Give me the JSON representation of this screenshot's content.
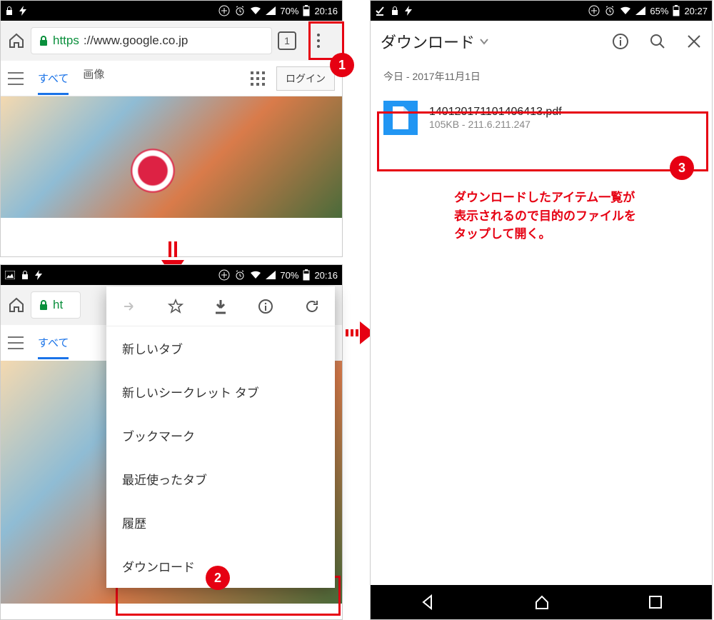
{
  "screen1": {
    "status": {
      "battery": "70%",
      "time": "20:16"
    },
    "url": {
      "httpsPrefix": "https",
      "rest": "://www.google.co.jp"
    },
    "tabCount": "1",
    "gtabs": {
      "all": "すべて",
      "images": "画像"
    },
    "login": "ログイン"
  },
  "screen2": {
    "status": {
      "battery": "70%",
      "time": "20:16"
    },
    "url": {
      "httpsPrefix": "ht"
    },
    "gtabs": {
      "all": "すべて"
    },
    "menu": {
      "items": [
        "新しいタブ",
        "新しいシークレット タブ",
        "ブックマーク",
        "最近使ったタブ",
        "履歴",
        "ダウンロード"
      ]
    }
  },
  "screen3": {
    "status": {
      "battery": "65%",
      "time": "20:27"
    },
    "title": "ダウンロード",
    "dateHeader": "今日 - 2017年11月1日",
    "file": {
      "name": "140120171101406413.pdf",
      "size": "105KB",
      "host": "211.6.211.247"
    }
  },
  "annotations": {
    "badge1": "1",
    "badge2": "2",
    "badge3": "3",
    "note": "ダウンロードしたアイテム一覧が\n表示されるので目的のファイルを\nタップして開く。"
  }
}
